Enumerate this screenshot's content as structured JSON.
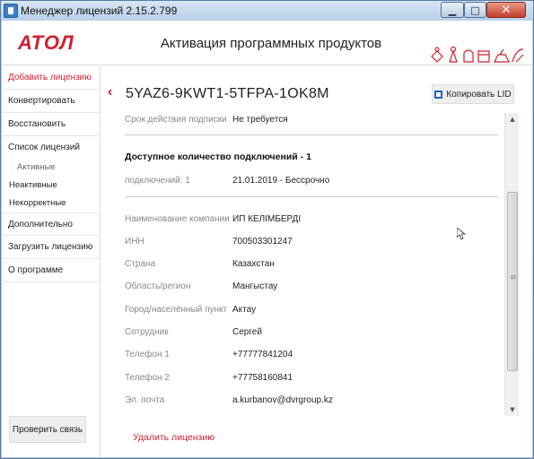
{
  "window": {
    "title": "Менеджер лицензий 2.15.2.799"
  },
  "header": {
    "logo": "АТОЛ",
    "title": "Активация программных продуктов"
  },
  "sidebar": {
    "items": [
      {
        "label": "Добавить лицензию",
        "active": true
      },
      {
        "label": "Конвертировать"
      },
      {
        "label": "Восстановить"
      },
      {
        "label": "Список лицензий"
      },
      {
        "label": "Активные",
        "sub": true,
        "active": true
      },
      {
        "label": "Неактивные",
        "sub": true
      },
      {
        "label": "Некорректные",
        "sub": true
      },
      {
        "label": "Дополнительно"
      },
      {
        "label": "Загрузить лицензию"
      },
      {
        "label": "О программе"
      }
    ],
    "check_button": "Проверить связь"
  },
  "main": {
    "license_key": "5YAZ6-9KWT1-5TFPA-1OK8M",
    "copy_button": "Копировать LID",
    "subscription": {
      "label": "Срок действия подписки",
      "value": "Не требуется"
    },
    "connections_title": "Доступное количество подключений - 1",
    "connections": {
      "label": "подключений: 1",
      "value": "21.01.2019 - Бессрочно"
    },
    "fields": [
      {
        "label": "Наименование компании",
        "value": "ИП КЕЛІМБЕРДІ"
      },
      {
        "label": "ИНН",
        "value": "700503301247"
      },
      {
        "label": "Страна",
        "value": "Казахстан"
      },
      {
        "label": "Область/регион",
        "value": "Мангыстау"
      },
      {
        "label": "Город/населённый пункт",
        "value": "Актау"
      },
      {
        "label": "Сотрудник",
        "value": "Сергей"
      },
      {
        "label": "Телефон 1",
        "value": "+77777841204"
      },
      {
        "label": "Телефон 2",
        "value": "+77758160841"
      },
      {
        "label": "Эл. почта",
        "value": "a.kurbanov@dvrgroup.kz"
      }
    ],
    "delete_link": "Удалить лицензию"
  },
  "colors": {
    "accent": "#d01f2f",
    "link_blue": "#1e63c4"
  }
}
